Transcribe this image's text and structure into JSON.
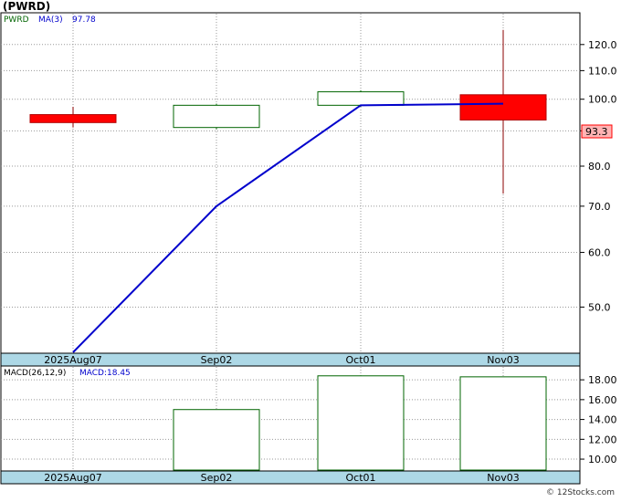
{
  "chart_data": [
    {
      "type": "candlestick",
      "title": "(PWRD)",
      "legend": {
        "ticker_label": "PWRD",
        "ma_label": "MA(3)",
        "ma_value": "97.78"
      },
      "categories": [
        "2025Aug07",
        "Sep02",
        "Oct01",
        "Nov03"
      ],
      "candles": [
        {
          "date": "2025Aug07",
          "open": 95.0,
          "high": 97.5,
          "low": 91.0,
          "close": 92.5,
          "direction": "down"
        },
        {
          "date": "Sep02",
          "open": 91.0,
          "high": 98.5,
          "low": 90.5,
          "close": 98.0,
          "direction": "up"
        },
        {
          "date": "Oct01",
          "open": 98.0,
          "high": 103.0,
          "low": 97.5,
          "close": 102.5,
          "direction": "up"
        },
        {
          "date": "Nov03",
          "open": 101.5,
          "high": 126.0,
          "low": 73.0,
          "close": 93.3,
          "direction": "down"
        }
      ],
      "ma_series": {
        "name": "MA(3)",
        "values": [
          43.0,
          70.0,
          98.0,
          98.5
        ]
      },
      "y_ticks": [
        "50.0",
        "60.0",
        "70.0",
        "80.0",
        "90.0",
        "100.0",
        "110.0",
        "120.0"
      ],
      "ylim": [
        43,
        133
      ],
      "y_scale": "log",
      "last_price_label": "93.3",
      "grid": true
    },
    {
      "type": "bar",
      "legend": {
        "label": "MACD(26,12,9)",
        "value_label": "MACD:18.45"
      },
      "categories": [
        "2025Aug07",
        "Sep02",
        "Oct01",
        "Nov03"
      ],
      "values": [
        null,
        15.0,
        18.4,
        18.3
      ],
      "y_ticks": [
        "10.00",
        "12.00",
        "14.00",
        "16.00",
        "18.00"
      ],
      "ylim": [
        8.9,
        19.3
      ],
      "grid": true
    }
  ],
  "watermark": "© 12Stocks.com",
  "colors": {
    "up_outline": "#006400",
    "down_fill": "#ff0000",
    "ma_line": "#0000cc",
    "axis_band": "#add8e6",
    "last_price_box": "#ffb3b3"
  }
}
